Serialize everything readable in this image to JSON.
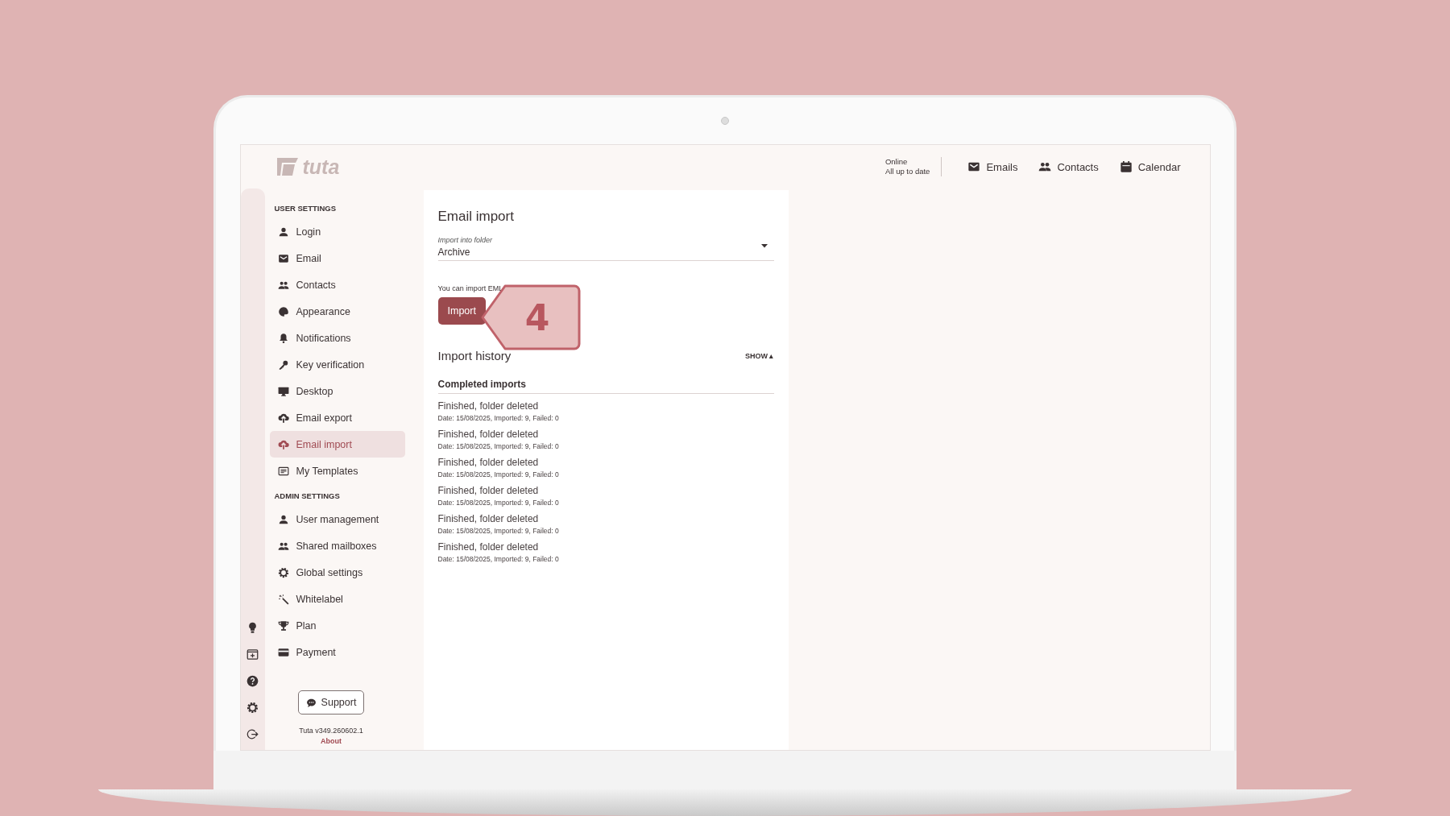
{
  "header": {
    "logo": "tuta",
    "status": "Online",
    "sync": "All up to date",
    "nav": [
      {
        "label": "Emails"
      },
      {
        "label": "Contacts"
      },
      {
        "label": "Calendar"
      }
    ]
  },
  "sidebar": {
    "sections": [
      {
        "title": "USER SETTINGS",
        "items": [
          {
            "label": "Login",
            "selected": false
          },
          {
            "label": "Email",
            "selected": false
          },
          {
            "label": "Contacts",
            "selected": false
          },
          {
            "label": "Appearance",
            "selected": false
          },
          {
            "label": "Notifications",
            "selected": false
          },
          {
            "label": "Key verification",
            "selected": false
          },
          {
            "label": "Desktop",
            "selected": false
          },
          {
            "label": "Email export",
            "selected": false
          },
          {
            "label": "Email import",
            "selected": true
          },
          {
            "label": "My Templates",
            "selected": false
          }
        ]
      },
      {
        "title": "ADMIN SETTINGS",
        "items": [
          {
            "label": "User management",
            "selected": false
          },
          {
            "label": "Shared mailboxes",
            "selected": false
          },
          {
            "label": "Global settings",
            "selected": false
          },
          {
            "label": "Whitelabel",
            "selected": false
          },
          {
            "label": "Plan",
            "selected": false
          },
          {
            "label": "Payment",
            "selected": false
          }
        ]
      }
    ],
    "support_button": "Support",
    "version": "Tuta v349.260602.1",
    "about_link": "About"
  },
  "content": {
    "title": "Email import",
    "folder_field": {
      "label": "Import into folder",
      "value": "Archive"
    },
    "hint": "You can import EML",
    "import_button": "Import",
    "callout": {
      "label": "4"
    },
    "history": {
      "title": "Import history",
      "toggle": "SHOW ▴",
      "subtitle": "Completed imports",
      "rows": [
        {
          "status": "Finished, folder deleted",
          "details": "Date: 15/08/2025, Imported: 9, Failed: 0"
        },
        {
          "status": "Finished, folder deleted",
          "details": "Date: 15/08/2025, Imported: 9, Failed: 0"
        },
        {
          "status": "Finished, folder deleted",
          "details": "Date: 15/08/2025, Imported: 9, Failed: 0"
        },
        {
          "status": "Finished, folder deleted",
          "details": "Date: 15/08/2025, Imported: 9, Failed: 0"
        },
        {
          "status": "Finished, folder deleted",
          "details": "Date: 15/08/2025, Imported: 9, Failed: 0"
        },
        {
          "status": "Finished, folder deleted",
          "details": "Date: 15/08/2025, Imported: 9, Failed: 0"
        }
      ]
    }
  }
}
